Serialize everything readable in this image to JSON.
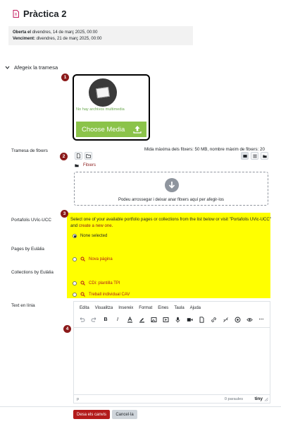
{
  "page": {
    "title": "Pràctica 2"
  },
  "dates": {
    "opened_label": "Oberta el",
    "opened_value": "divendres, 14 de març 2025, 00:00",
    "due_label": "Venciment:",
    "due_value": "divendres, 21 de març 2025, 00:00"
  },
  "section": {
    "toggle_label": "Afegeix la tramesa"
  },
  "steps": [
    "1",
    "2",
    "3",
    "4"
  ],
  "media": {
    "empty_text": "No hay archivos multimedia",
    "choose_label": "Choose Media"
  },
  "files": {
    "label": "Tramesa de fitxers",
    "max_size": "Mida màxima dels fitxers: 50 MB, nombre màxim de fitxers: 20",
    "path": "Fitxers",
    "drop_text": "Podeu arrossegar i deixar anar fitxers aquí per afegir-los"
  },
  "portfolio": {
    "label": "Portafolis UVic-UCC",
    "text_before": "Select one of your available portfolio pages or collections from the list below or visit \"Portafolis UVic-UCC\" and",
    "create_link": "create a new one",
    "text_after": ".",
    "none_selected": "None selected",
    "pages_label": "Pages by Eulàlia",
    "pages": [
      "Nova pàgina"
    ],
    "collections_label": "Collections by Eulàlia",
    "collections": [
      "CDi: plantilla TPI",
      "Treball individual CAV"
    ]
  },
  "online_text": {
    "label": "Text en línia",
    "menu": [
      "Edita",
      "Visualitza",
      "Insereix",
      "Format",
      "Eines",
      "Taula",
      "Ajuda"
    ],
    "status_path": "p",
    "word_count": "0 paraules",
    "brand": "tiny"
  },
  "actions": {
    "save": "Desa els canvis",
    "cancel": "Cancel·la"
  },
  "colors": {
    "accent": "#b31b1b",
    "highlight": "#ffff00",
    "media_button": "#8bc34a"
  }
}
